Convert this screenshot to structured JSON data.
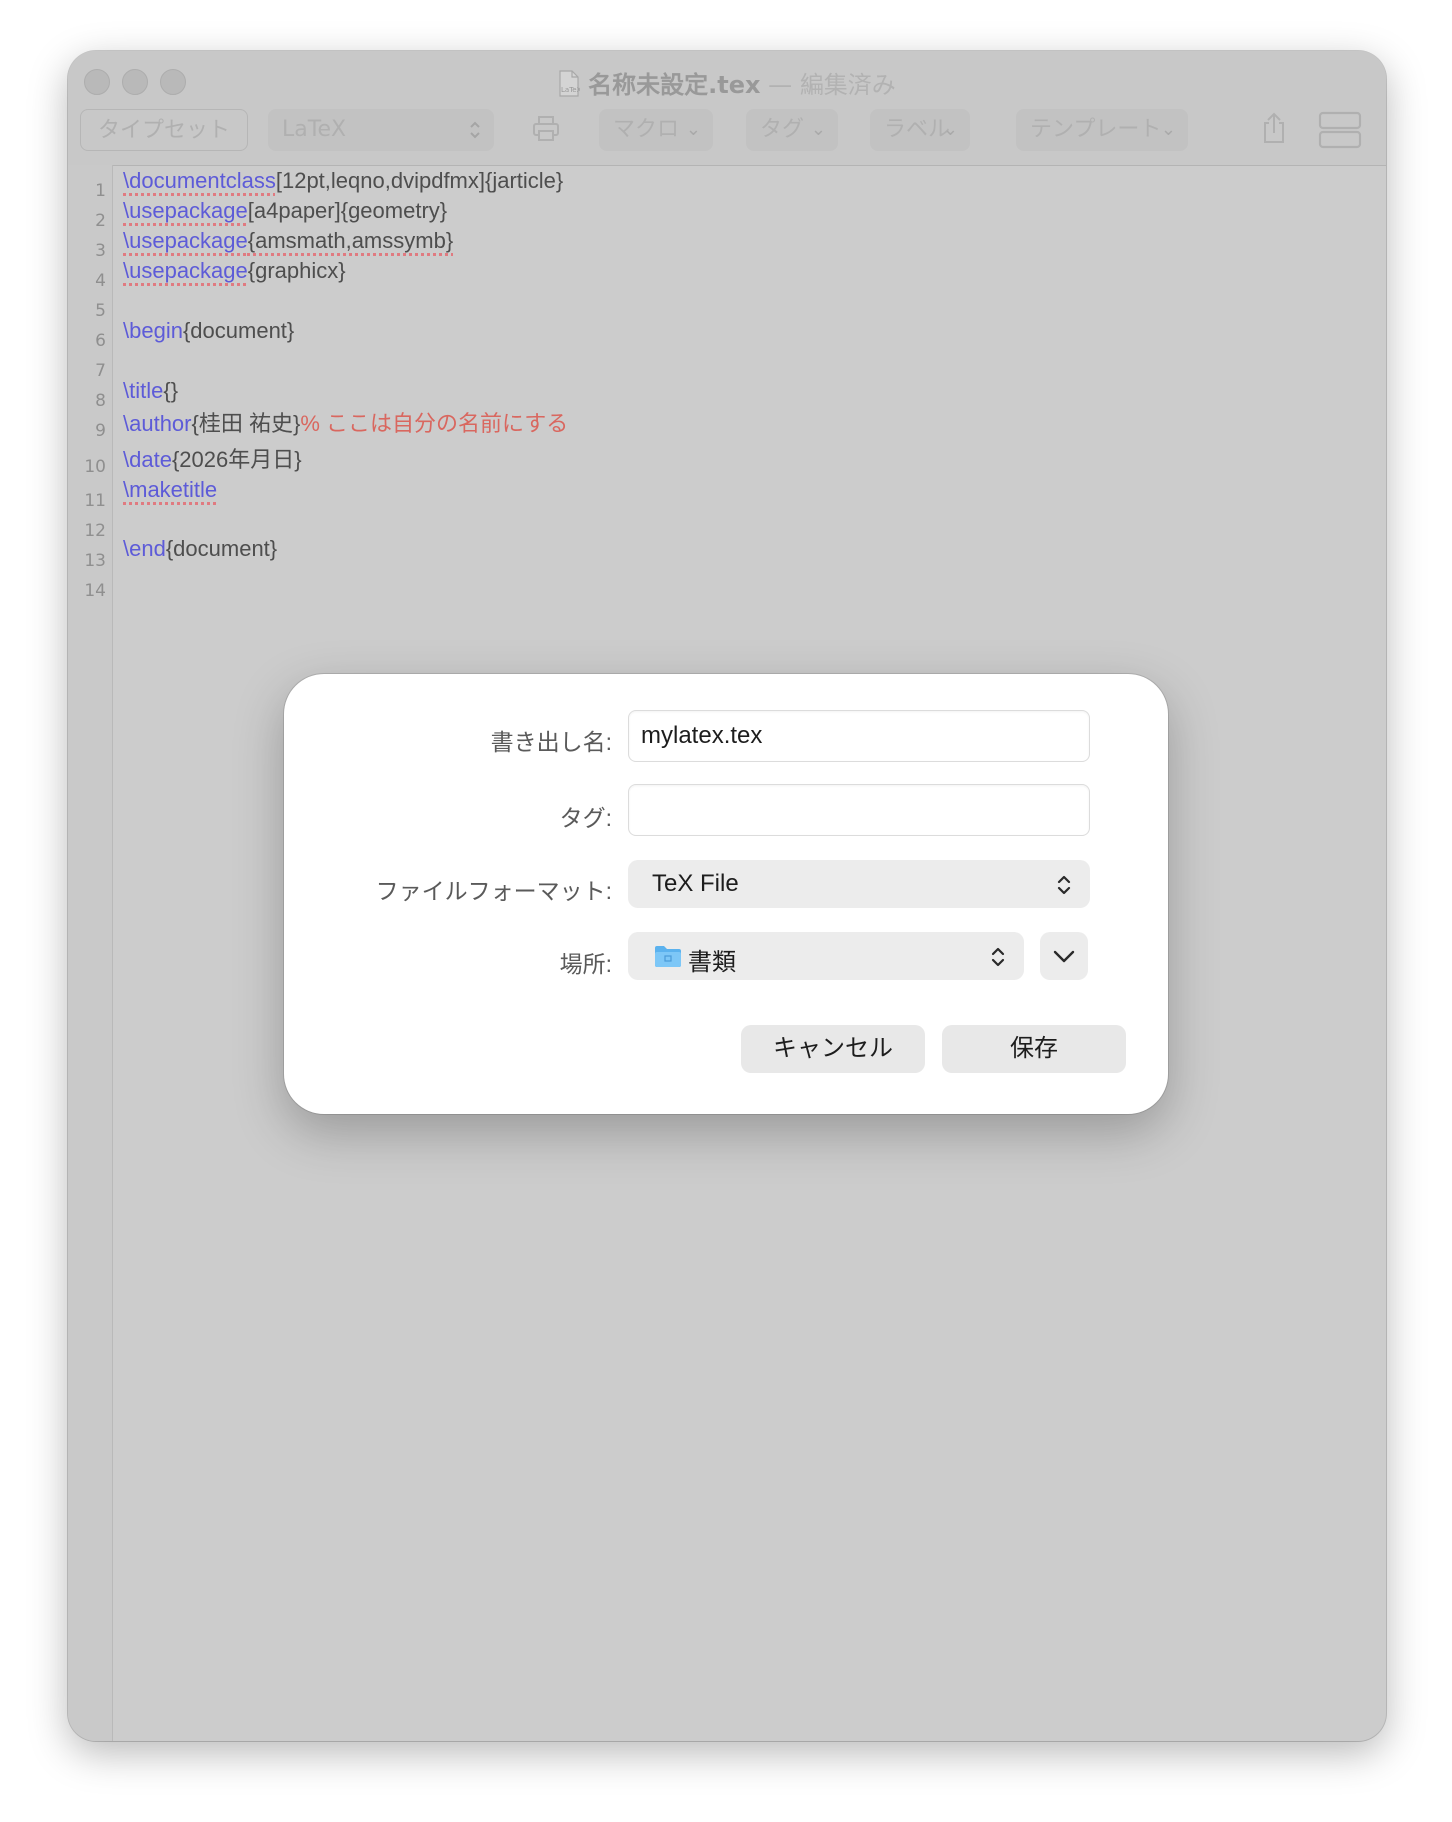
{
  "window": {
    "title": "名称未設定.tex",
    "separator": "—",
    "state": "編集済み",
    "doc_icon": "latex-document-icon"
  },
  "toolbar": {
    "typeset": "タイプセット",
    "engine": "LaTeX",
    "macro": "マクロ",
    "tag": "タグ",
    "label": "ラベル",
    "template": "テンプレート",
    "icons": [
      "printer-icon",
      "share-icon",
      "split-view-icon"
    ]
  },
  "editor": {
    "line_numbers": [
      "1",
      "2",
      "3",
      "4",
      "5",
      "6",
      "7",
      "8",
      "9",
      "10",
      "11",
      "12",
      "13",
      "14"
    ],
    "l1": {
      "cmd": "\\documentclass",
      "args": "[12pt,leqno,dvipdfmx]{jarticle}"
    },
    "l2": {
      "cmd": "\\usepackage",
      "args": "[a4paper]{geometry}"
    },
    "l3": {
      "cmd": "\\usepackage",
      "args": "{amsmath,amssymb}"
    },
    "l4": {
      "cmd": "\\usepackage",
      "args": "{graphicx}"
    },
    "l6": {
      "cmd": "\\begin",
      "args": "{document}"
    },
    "l8": {
      "cmd": "\\title",
      "args": "{}"
    },
    "l9": {
      "cmd": "\\author",
      "args": "{桂田 祐史}",
      "comment": "% ここは自分の名前にする"
    },
    "l10": {
      "cmd": "\\date",
      "args": "{2026年月日}"
    },
    "l11": {
      "cmd": "\\maketitle",
      "args": ""
    },
    "l13": {
      "cmd": "\\end",
      "args": "{document}"
    }
  },
  "save_dialog": {
    "export_name_label": "書き出し名:",
    "export_name_value": "mylatex.tex",
    "tags_label": "タグ:",
    "tags_value": "",
    "format_label": "ファイルフォーマット:",
    "format_value": "TeX File",
    "location_label": "場所:",
    "location_value": "書類",
    "location_icon": "folder-icon",
    "cancel": "キャンセル",
    "save": "保存"
  }
}
